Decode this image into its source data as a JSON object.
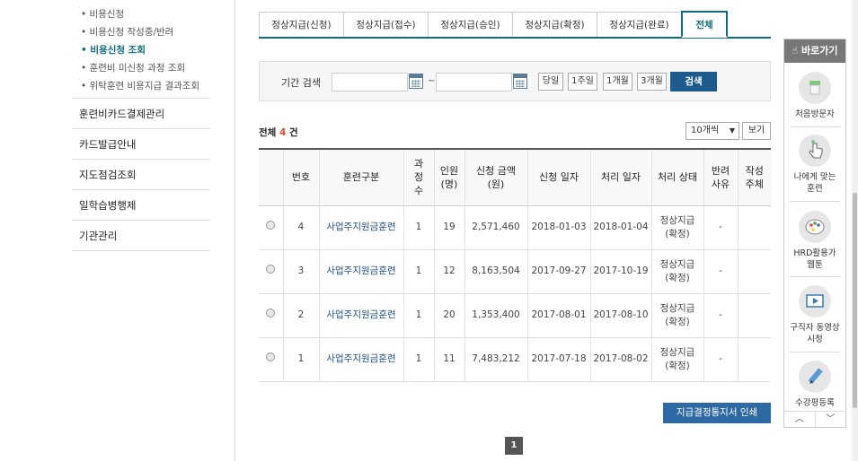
{
  "sidebar": {
    "sub_items": [
      "비용신청",
      "비용신청 작성중/반려",
      "비용신청 조회",
      "훈련비 미신청 과정 조회",
      "위탁훈련 비용지급 결과조회"
    ],
    "menu_items": [
      "훈련비카드결제관리",
      "카드발급안내",
      "지도점검조회",
      "일학습병행제",
      "기관관리"
    ]
  },
  "tabs": [
    "정상지급(신청)",
    "정상지급(접수)",
    "정상지급(승인)",
    "정상지급(확정)",
    "정상지급(완료)",
    "전체"
  ],
  "search": {
    "label": "기간 검색",
    "tilde": "~",
    "period_buttons": [
      "당일",
      "1주일",
      "1개월",
      "3개월"
    ],
    "search_button": "검색"
  },
  "count": {
    "prefix": "전체",
    "number": "4",
    "suffix": "건"
  },
  "page_size": {
    "selected": "10개씩",
    "view_button": "보기"
  },
  "table": {
    "headers": [
      "",
      "번호",
      "훈련구분",
      "과정수",
      "인원(명)",
      "신청 금액(원)",
      "신청 일자",
      "처리 일자",
      "처리 상태",
      "반려사유",
      "작성주체"
    ],
    "rows": [
      [
        "4",
        "사업주지원금훈련",
        "1",
        "19",
        "2,571,460",
        "2018-01-03",
        "2018-01-04",
        "정상지급(확정)",
        "-",
        ""
      ],
      [
        "3",
        "사업주지원금훈련",
        "1",
        "12",
        "8,163,504",
        "2017-09-27",
        "2017-10-19",
        "정상지급(확정)",
        "-",
        ""
      ],
      [
        "2",
        "사업주지원금훈련",
        "1",
        "20",
        "1,353,400",
        "2017-08-01",
        "2017-08-10",
        "정상지급(확정)",
        "-",
        ""
      ],
      [
        "1",
        "사업주지원금훈련",
        "1",
        "11",
        "7,483,212",
        "2017-07-18",
        "2017-08-02",
        "정상지급(확정)",
        "-",
        ""
      ]
    ]
  },
  "print_button": "지급결정통지서 인쇄",
  "pagination": {
    "current": "1"
  },
  "quick": {
    "title": "바로가기",
    "items": [
      "처음방문자",
      "나에게 맞는훈련",
      "HRD활용가 웹툰",
      "구직자 동영상시청",
      "수강평등록"
    ],
    "up": "︿",
    "down": "﹀"
  }
}
